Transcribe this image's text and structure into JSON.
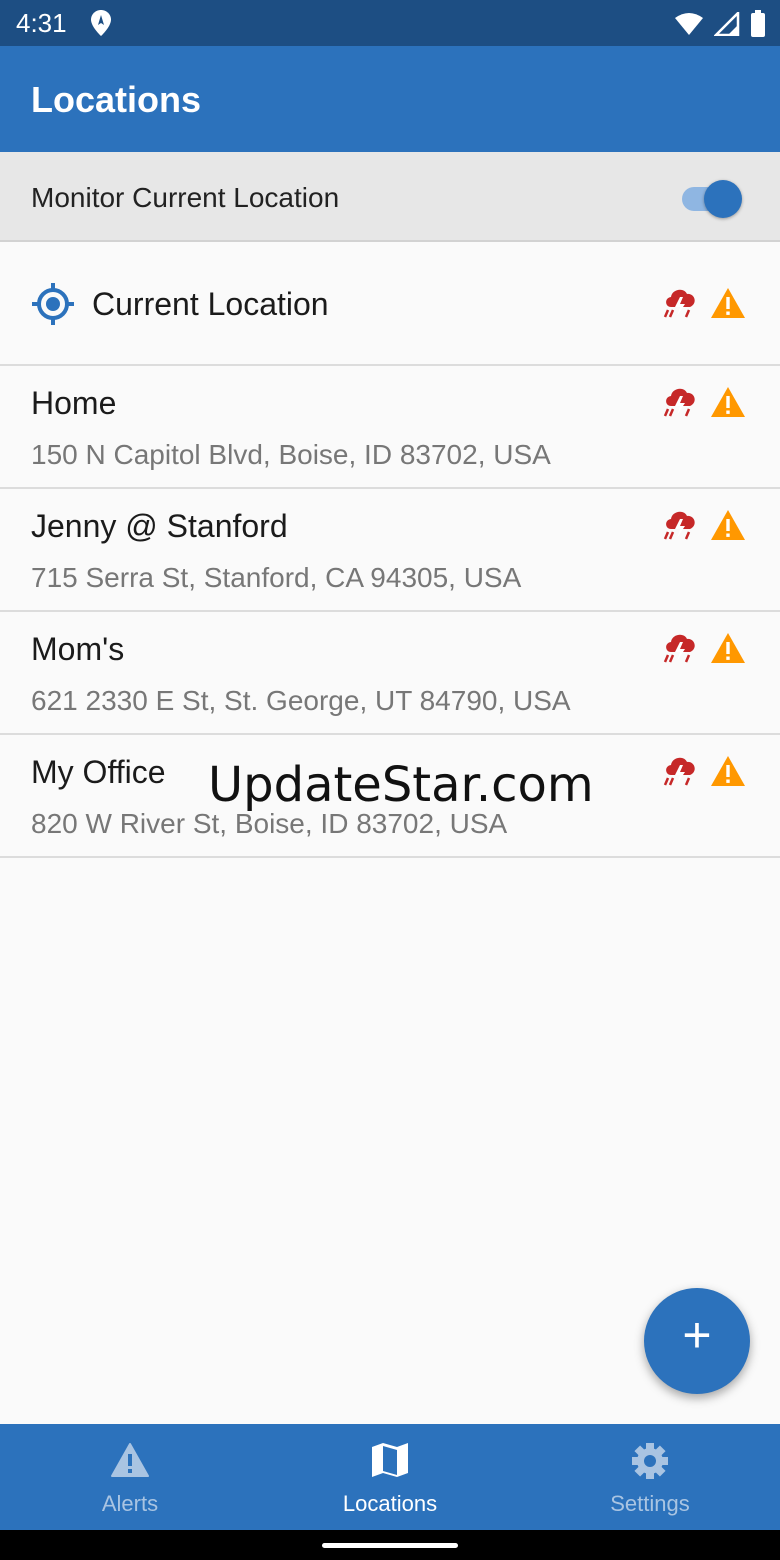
{
  "status_bar": {
    "time": "4:31",
    "icons": [
      "location-pin-icon",
      "wifi-icon",
      "cell-signal-icon",
      "battery-icon"
    ]
  },
  "app_bar": {
    "title": "Locations"
  },
  "monitor": {
    "label": "Monitor Current Location",
    "enabled": true
  },
  "current_location": {
    "label": "Current Location"
  },
  "locations": [
    {
      "name": "Home",
      "address": "150 N Capitol Blvd, Boise, ID 83702, USA"
    },
    {
      "name": "Jenny @ Stanford",
      "address": "715 Serra St, Stanford, CA 94305, USA"
    },
    {
      "name": "Mom's",
      "address": "621 2330 E St, St. George, UT 84790, USA"
    },
    {
      "name": "My Office",
      "address": "820 W River St, Boise, ID 83702, USA"
    }
  ],
  "row_icons": [
    "storm-icon",
    "warning-icon"
  ],
  "watermark": "UpdateStar.com",
  "fab": {
    "icon": "plus-icon",
    "symbol": "+"
  },
  "bottom_nav": [
    {
      "label": "Alerts",
      "icon": "alert-triangle-icon",
      "active": false
    },
    {
      "label": "Locations",
      "icon": "map-icon",
      "active": true
    },
    {
      "label": "Settings",
      "icon": "gear-icon",
      "active": false
    }
  ],
  "colors": {
    "primary": "#2c72bc",
    "status_bar": "#1d4e83",
    "storm": "#c62828",
    "warning": "#ff9800"
  }
}
